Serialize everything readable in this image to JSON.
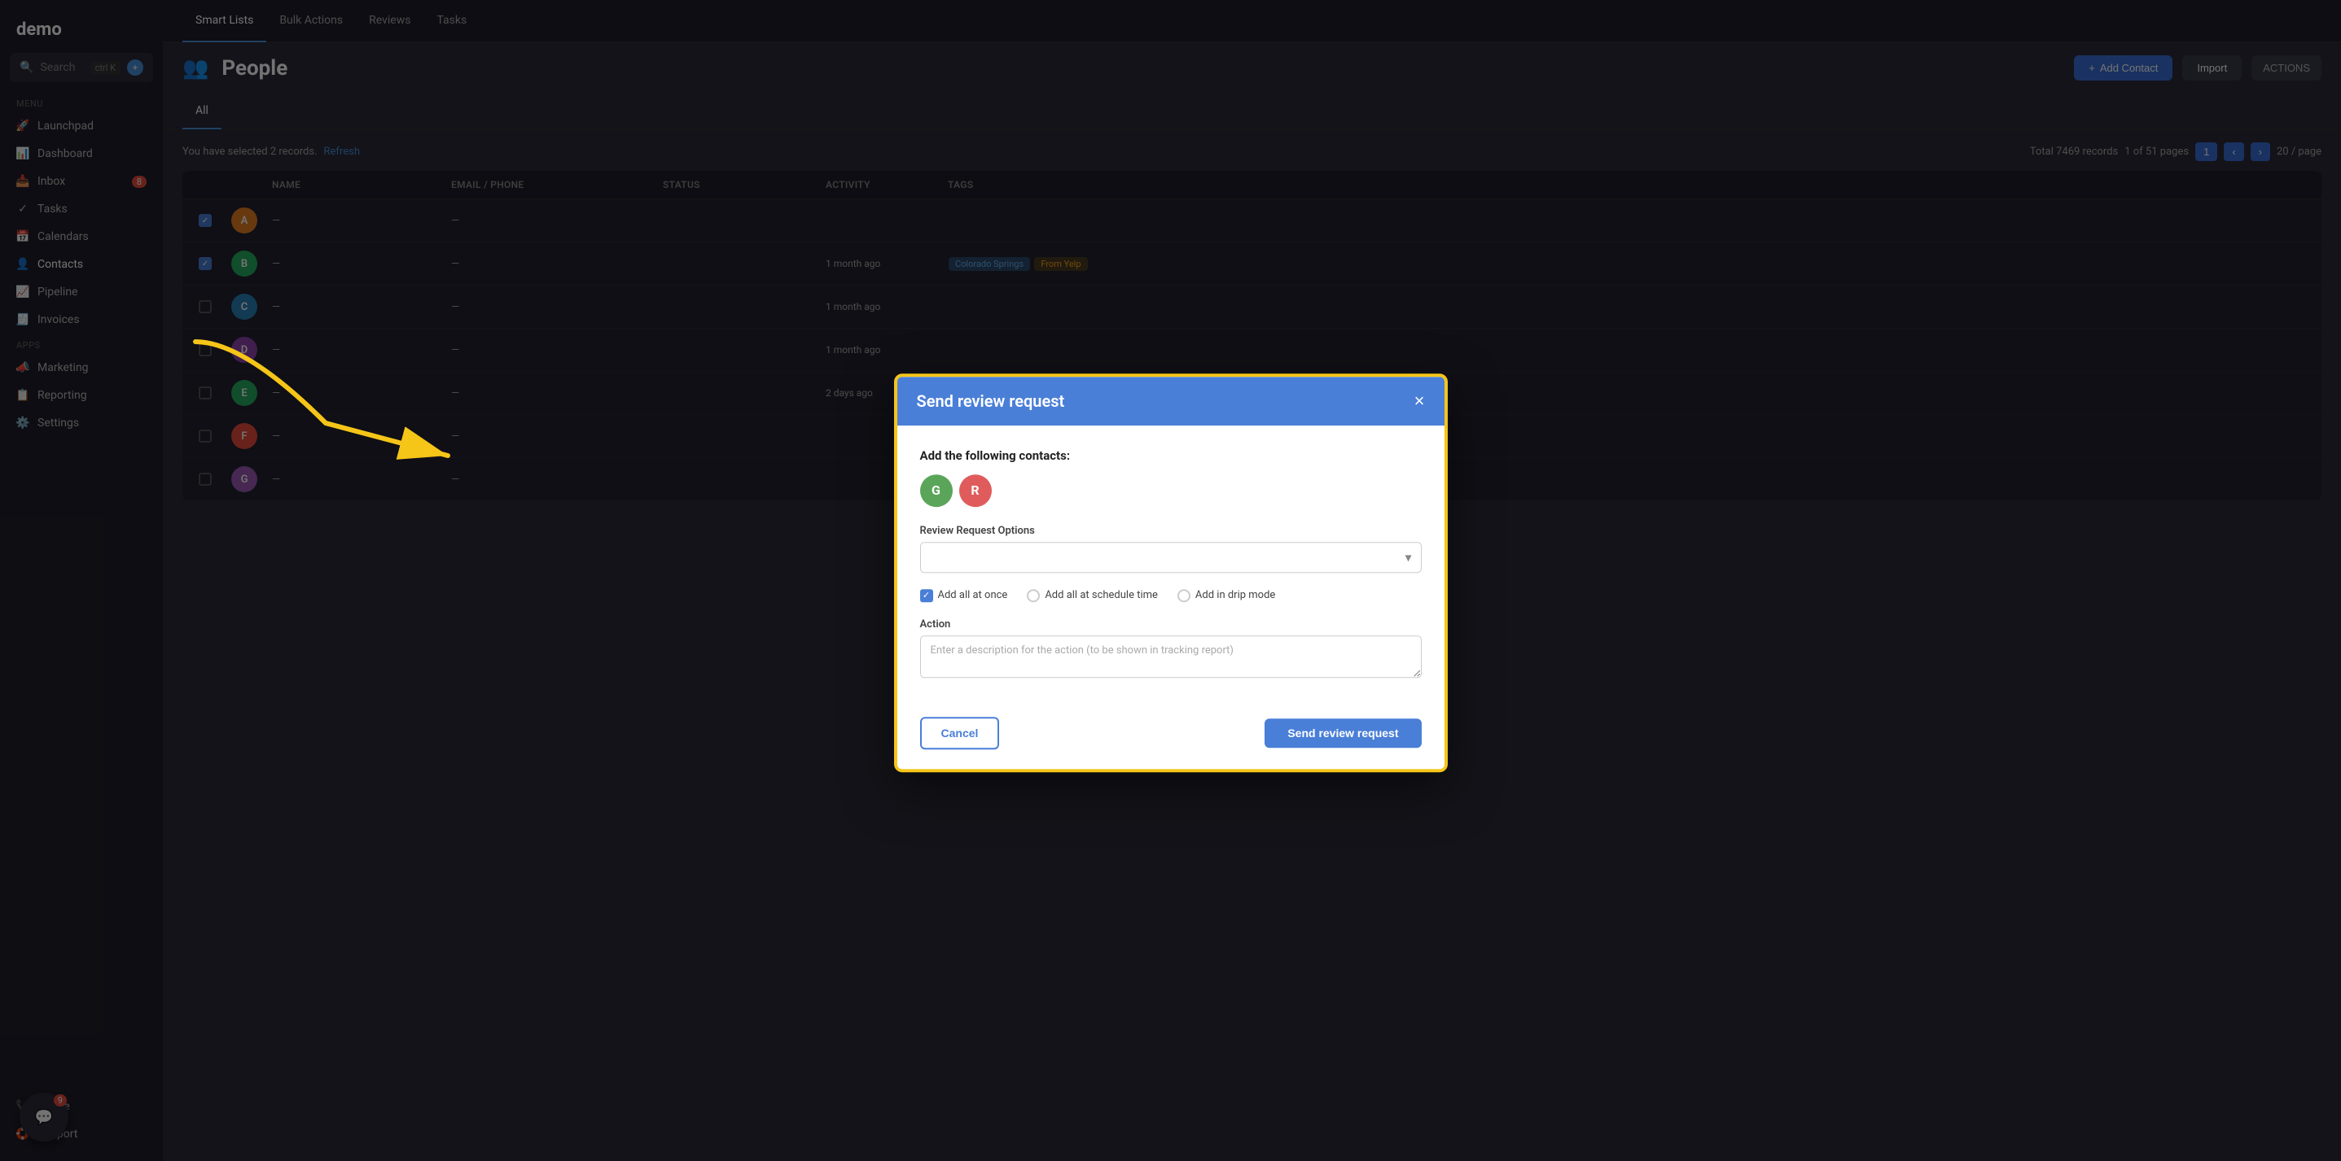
{
  "app": {
    "name": "demo"
  },
  "sidebar": {
    "search_label": "Search",
    "search_shortcut": "ctrl K",
    "sections": [
      {
        "label": "MENU",
        "items": [
          {
            "id": "launchpad",
            "label": "Launchpad",
            "icon": "🚀"
          },
          {
            "id": "dashboard",
            "label": "Dashboard",
            "icon": "📊"
          },
          {
            "id": "inbox",
            "label": "Inbox",
            "icon": "📥",
            "badge": "8"
          },
          {
            "id": "tasks",
            "label": "Tasks",
            "icon": "✓"
          },
          {
            "id": "calendars",
            "label": "Calendars",
            "icon": "📅"
          },
          {
            "id": "contacts",
            "label": "Contacts",
            "icon": "👤",
            "active": true
          },
          {
            "id": "pipeline",
            "label": "Pipeline",
            "icon": "📈"
          },
          {
            "id": "invoices",
            "label": "Invoices",
            "icon": "🧾"
          }
        ]
      },
      {
        "label": "APPS",
        "items": [
          {
            "id": "marketing",
            "label": "Marketing",
            "icon": "📣"
          },
          {
            "id": "reporting",
            "label": "Reporting",
            "icon": "📋"
          },
          {
            "id": "settings",
            "label": "Settings",
            "icon": "⚙️"
          }
        ]
      }
    ],
    "bottom_items": [
      {
        "id": "phone",
        "label": "Phone",
        "icon": "📞"
      },
      {
        "id": "support",
        "label": "Support",
        "icon": "🛟"
      }
    ]
  },
  "topnav": {
    "items": [
      {
        "id": "smart-lists",
        "label": "Smart Lists",
        "active": true
      },
      {
        "id": "bulk-actions",
        "label": "Bulk Actions"
      },
      {
        "id": "reviews",
        "label": "Reviews"
      },
      {
        "id": "tasks",
        "label": "Tasks"
      }
    ]
  },
  "page": {
    "title": "People",
    "title_icon": "👥"
  },
  "subheader": {
    "tabs": [
      {
        "id": "all",
        "label": "All",
        "active": true
      }
    ],
    "actions": {
      "btn1_label": "Add Contact",
      "btn2_label": "Import",
      "btn3_label": "ACTIONS"
    }
  },
  "table": {
    "info": "You have selected 2 records.",
    "refresh_label": "Refresh",
    "pagination": {
      "total_records": "Total 7469 records",
      "pages": "1 of 51 pages",
      "page_label": "1"
    },
    "columns": [
      "",
      "",
      "Name",
      "Email / Phone",
      "Status",
      "Activity",
      "Tags"
    ],
    "rows": [
      {
        "avatar_color": "#e67e22",
        "avatar_letter": "A",
        "name": "—",
        "email": "—",
        "status": "",
        "activity": "",
        "tags": "",
        "checked": true
      },
      {
        "avatar_color": "#27ae60",
        "avatar_letter": "B",
        "name": "—",
        "email": "—",
        "status": "",
        "activity": "1 month ago",
        "tags": "Colorado Springs From Yelp",
        "checked": true
      },
      {
        "avatar_color": "#2980b9",
        "avatar_letter": "C",
        "name": "—",
        "email": "—",
        "status": "",
        "activity": "1 month ago",
        "tags": ""
      },
      {
        "avatar_color": "#8e44ad",
        "avatar_letter": "D",
        "name": "—",
        "email": "—",
        "status": "",
        "activity": "1 month ago",
        "tags": ""
      },
      {
        "avatar_color": "#27ae60",
        "avatar_letter": "E",
        "name": "—",
        "email": "—",
        "status": "",
        "activity": "2 days ago",
        "tags": ""
      },
      {
        "avatar_color": "#e74c3c",
        "avatar_letter": "F",
        "name": "—",
        "email": "—",
        "status": "",
        "activity": "",
        "tags": ""
      },
      {
        "avatar_color": "#9b59b6",
        "avatar_letter": "G",
        "name": "—",
        "email": "—",
        "status": "",
        "activity": "",
        "tags": ""
      }
    ]
  },
  "modal": {
    "title": "Send review request",
    "close_label": "×",
    "contacts_label": "Add the following contacts:",
    "contacts": [
      {
        "letter": "G",
        "color": "#5ba55b"
      },
      {
        "letter": "R",
        "color": "#e05c5c"
      }
    ],
    "review_options_label": "Review Request Options",
    "review_options_placeholder": "",
    "radio_options": [
      {
        "id": "add-all-at-once",
        "label": "Add all at once",
        "checked": true,
        "type": "checkbox"
      },
      {
        "id": "add-all-at-schedule-time",
        "label": "Add all at schedule time",
        "checked": false,
        "type": "radio"
      },
      {
        "id": "add-in-drip-mode",
        "label": "Add in drip mode",
        "checked": false,
        "type": "radio"
      }
    ],
    "action_label": "Action",
    "action_placeholder": "Enter a description for the action (to be shown in tracking report)",
    "cancel_label": "Cancel",
    "send_label": "Send review request"
  },
  "annotation": {
    "arrow_color": "#f5c518"
  },
  "bottom_chat": {
    "badge": "9"
  }
}
